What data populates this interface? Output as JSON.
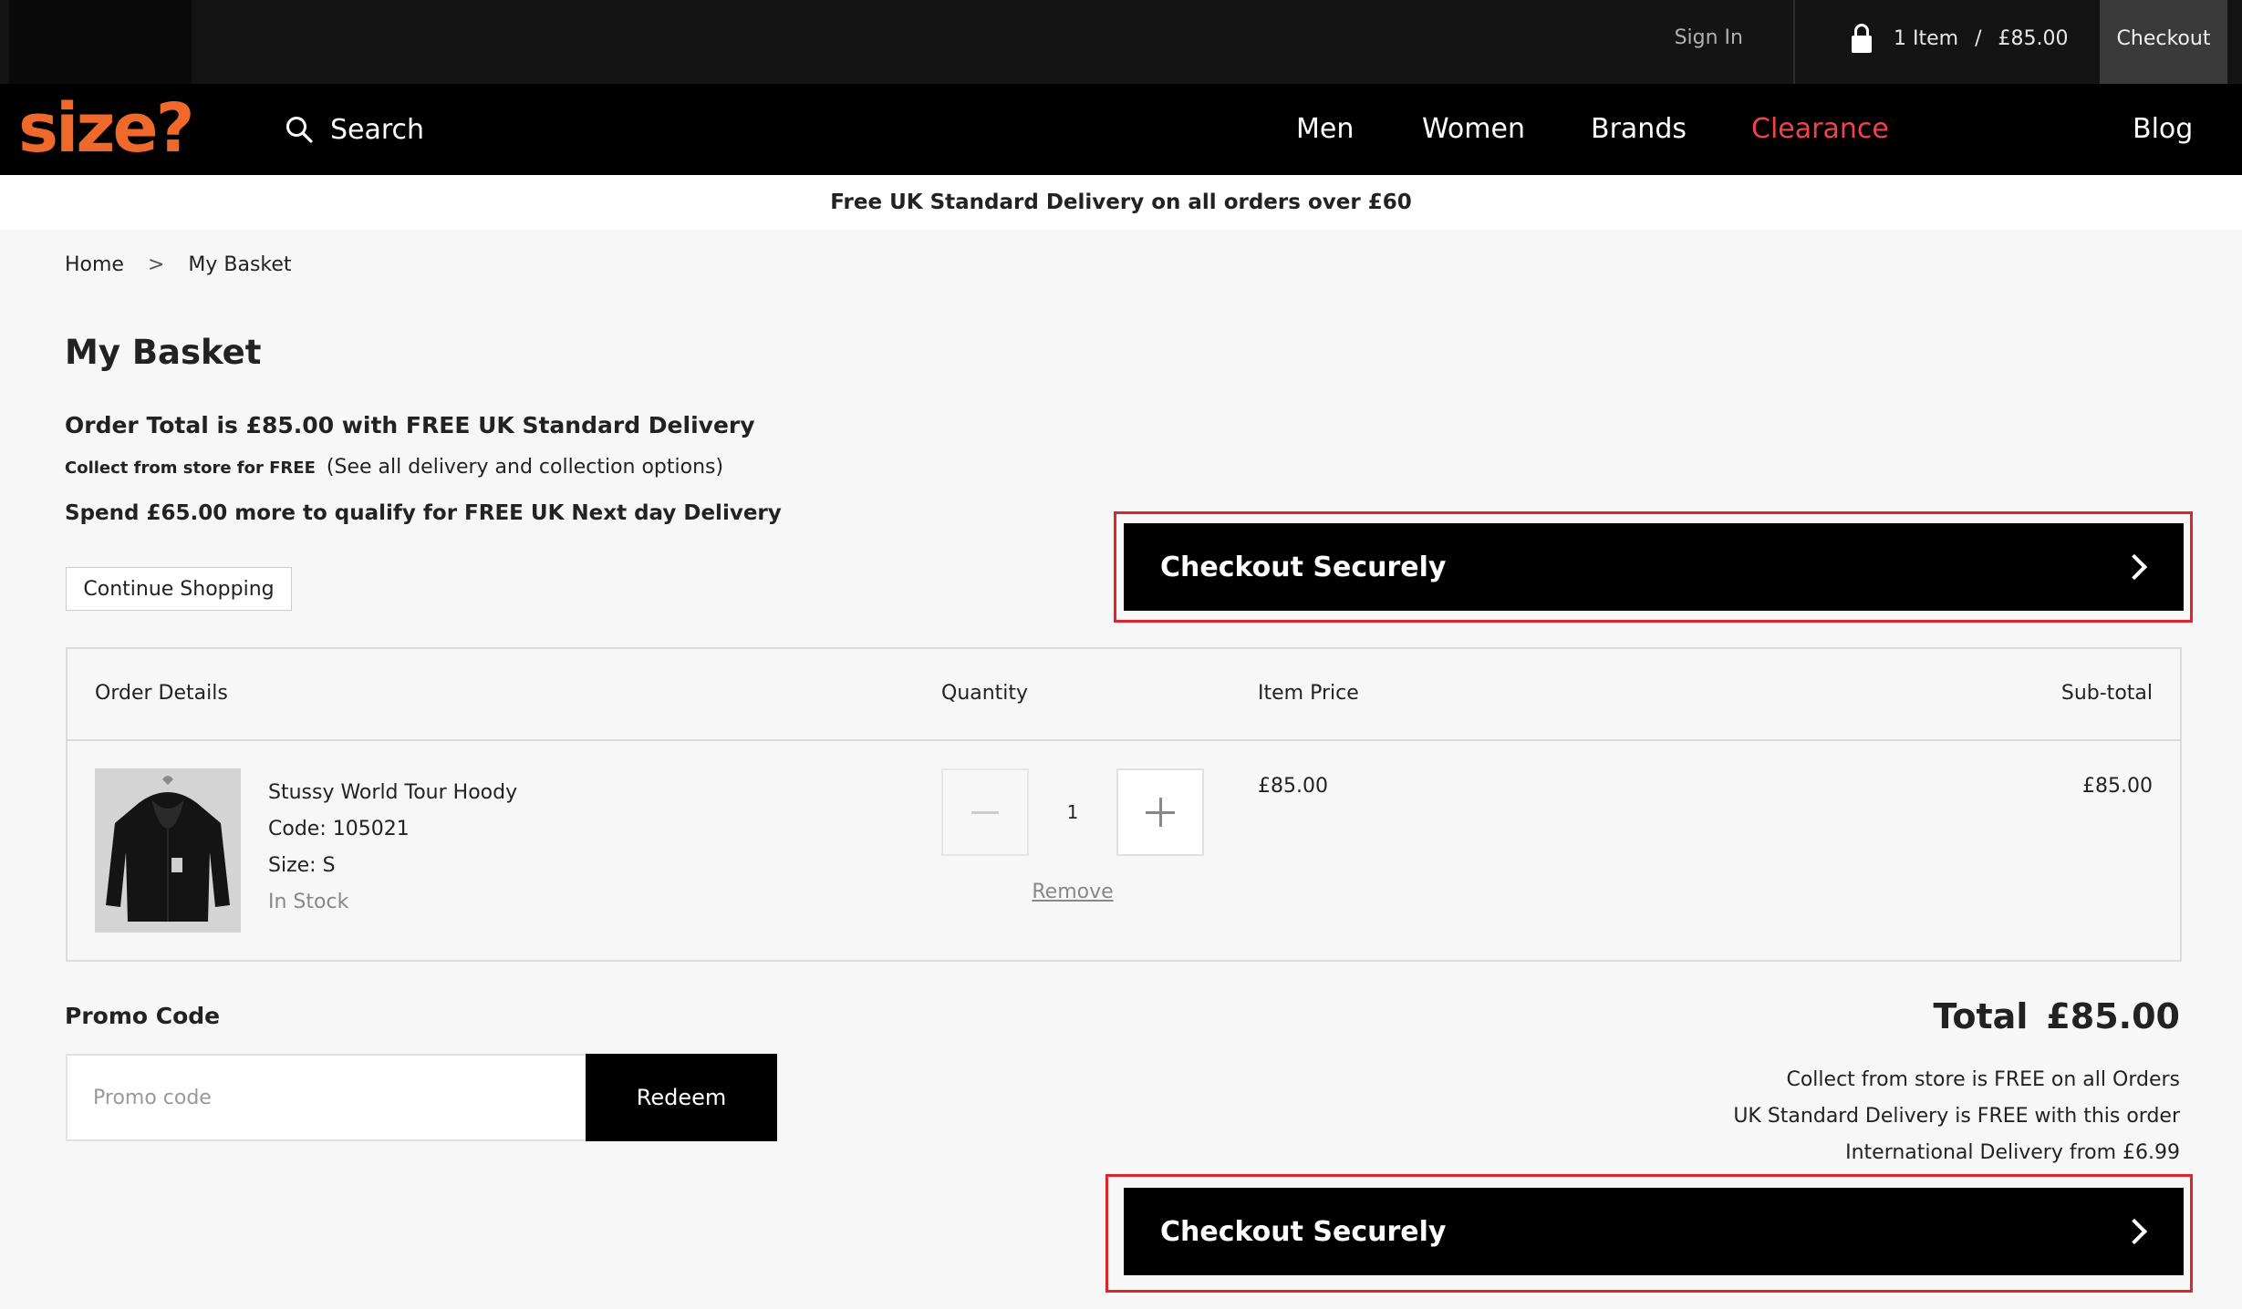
{
  "topbar": {
    "sign_in": "Sign In",
    "cart_count": "1 Item",
    "cart_sep": "/",
    "cart_total": "£85.00",
    "checkout": "Checkout"
  },
  "nav": {
    "logo": "size?",
    "search": "Search",
    "items": [
      "Men",
      "Women",
      "Brands",
      "Clearance",
      "Blog"
    ],
    "clearance_color": "#f0434e",
    "logo_color": "#ef6a2a"
  },
  "banner": "Free UK Standard Delivery on all orders over £60",
  "breadcrumb": {
    "home": "Home",
    "sep": ">",
    "current": "My Basket"
  },
  "basket": {
    "title": "My Basket",
    "order_total": "Order Total is £85.00 with FREE UK Standard Delivery",
    "collect_bold": "Collect from store for FREE",
    "collect_link": "(See all delivery and collection options)",
    "spend_more": "Spend £65.00 more to qualify for FREE UK  Next day Delivery",
    "continue": "Continue Shopping",
    "checkout_label": "Checkout Securely"
  },
  "table": {
    "headers": {
      "details": "Order Details",
      "quantity": "Quantity",
      "price": "Item Price",
      "subtotal": "Sub-total"
    },
    "item": {
      "name": "Stussy World Tour Hoody",
      "code": "Code: 105021",
      "size": "Size: S",
      "stock": "In Stock",
      "quantity": "1",
      "remove": "Remove",
      "price": "£85.00",
      "subtotal": "£85.00"
    }
  },
  "promo": {
    "label": "Promo Code",
    "placeholder": "Promo code",
    "redeem": "Redeem"
  },
  "totals": {
    "label": "Total",
    "value": "£85.00",
    "notes": [
      "Collect from store is  FREE on all Orders",
      "UK Standard Delivery is FREE with this order",
      "International Delivery from £6.99"
    ]
  },
  "icons": {
    "search": "search-icon",
    "lock": "lock-icon",
    "chevron": "chevron-right-icon"
  }
}
